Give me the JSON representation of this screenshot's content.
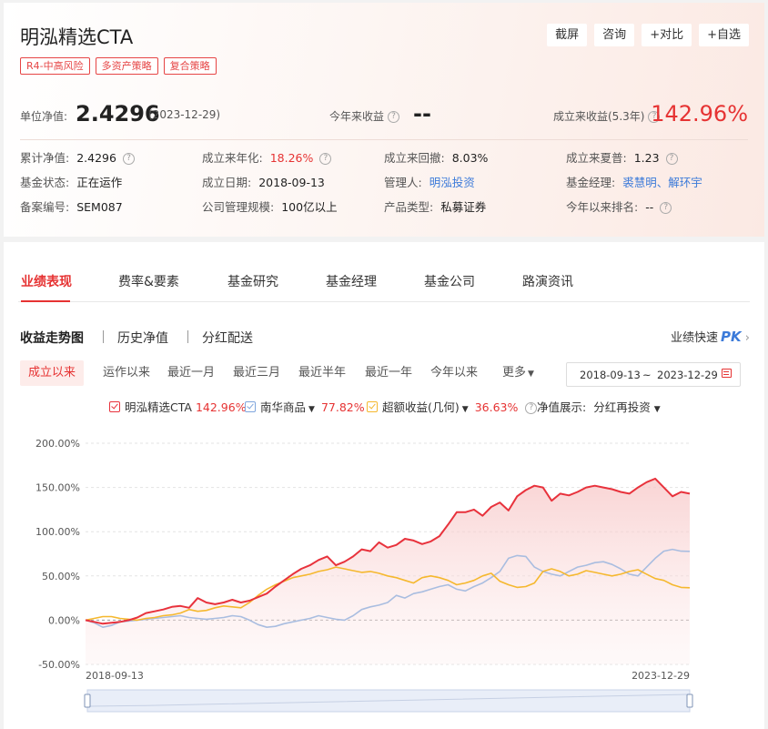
{
  "fund": {
    "title": "明泓精选CTA",
    "tags": [
      "R4-中高风险",
      "多资产策略",
      "复合策略"
    ],
    "actions": [
      "截屏",
      "咨询",
      "+对比",
      "+自选"
    ],
    "nav_label": "单位净值:",
    "nav_value": "2.4296",
    "nav_date": "(2023-12-29)",
    "ytd_label": "今年来收益",
    "ytd_value": "--",
    "since_label": "成立来收益(5.3年)",
    "since_value": "142.96%"
  },
  "info": [
    [
      {
        "label": "累计净值:",
        "value": "2.4296",
        "help": true,
        "style": ""
      },
      {
        "label": "成立来年化:",
        "value": "18.26%",
        "help": true,
        "style": "red"
      },
      {
        "label": "成立来回撤:",
        "value": "8.03%",
        "help": false,
        "style": ""
      },
      {
        "label": "成立来夏普:",
        "value": "1.23",
        "help": true,
        "style": ""
      }
    ],
    [
      {
        "label": "基金状态:",
        "value": "正在运作",
        "help": false,
        "style": ""
      },
      {
        "label": "成立日期:",
        "value": "2018-09-13",
        "help": false,
        "style": ""
      },
      {
        "label": "管理人:",
        "value": "明泓投资",
        "help": false,
        "style": "link"
      },
      {
        "label": "基金经理:",
        "value": "裘慧明、解环宇",
        "help": false,
        "style": "link"
      }
    ],
    [
      {
        "label": "备案编号:",
        "value": "SEM087",
        "help": false,
        "style": ""
      },
      {
        "label": "公司管理规模:",
        "value": "100亿以上",
        "help": false,
        "style": ""
      },
      {
        "label": "产品类型:",
        "value": "私募证券",
        "help": false,
        "style": ""
      },
      {
        "label": "今年以来排名:",
        "value": "--",
        "help": true,
        "style": ""
      }
    ]
  ],
  "tabs": [
    "业绩表现",
    "费率&要素",
    "基金研究",
    "基金经理",
    "基金公司",
    "路演资讯"
  ],
  "subtabs": [
    "收益走势图",
    "历史净值",
    "分红配送"
  ],
  "pk_label": "业绩快速",
  "pk_badge": "PK",
  "ranges": [
    "成立以来",
    "运作以来",
    "最近一月",
    "最近三月",
    "最近半年",
    "最近一年",
    "今年以来",
    "更多"
  ],
  "date_from": "2018-09-13",
  "date_sep": "~",
  "date_to": "2023-12-29",
  "legend": {
    "fund_name": "明泓精选CTA",
    "fund_pct": "142.96%",
    "bench_name": "南华商品",
    "bench_pct": "77.82%",
    "excess_name": "超额收益(几何)",
    "excess_pct": "36.63%",
    "nav_display_label": "净值展示:",
    "nav_display_value": "分红再投资"
  },
  "colors": {
    "accent": "#e63333",
    "fund": "#e8323c",
    "benchmark": "#a9bde0",
    "excess": "#f5b82e",
    "link": "#3b7ad9"
  },
  "chart_data": {
    "type": "line",
    "x_start": "2018-09-13",
    "x_end": "2023-12-29",
    "x_tick_labels": [
      "2018-09-13",
      "2023-12-29"
    ],
    "y_ticks": [
      "200.00%",
      "150.00%",
      "100.00%",
      "50.00%",
      "0.00%",
      "-50.00%"
    ],
    "ylim": [
      -50,
      200
    ],
    "grid": true,
    "series": [
      {
        "name": "明泓精选CTA",
        "color": "#e8323c",
        "area": true,
        "values": [
          0,
          -2,
          -4,
          -3,
          -2,
          0,
          3,
          8,
          10,
          12,
          15,
          16,
          14,
          25,
          20,
          18,
          20,
          23,
          20,
          22,
          26,
          30,
          38,
          45,
          52,
          58,
          62,
          68,
          72,
          62,
          66,
          72,
          80,
          78,
          88,
          82,
          85,
          92,
          90,
          86,
          89,
          95,
          108,
          122,
          122,
          125,
          118,
          128,
          133,
          124,
          140,
          147,
          152,
          150,
          135,
          143,
          141,
          145,
          150,
          152,
          150,
          148,
          145,
          143,
          150,
          156,
          160,
          150,
          140,
          145,
          143
        ]
      },
      {
        "name": "南华商品",
        "color": "#a9bde0",
        "area": false,
        "values": [
          0,
          -3,
          -8,
          -6,
          -2,
          -1,
          0,
          1,
          2,
          3,
          4,
          5,
          3,
          2,
          1,
          2,
          3,
          5,
          4,
          0,
          -5,
          -8,
          -7,
          -4,
          -2,
          0,
          2,
          5,
          3,
          1,
          0,
          5,
          12,
          15,
          17,
          20,
          28,
          25,
          30,
          32,
          35,
          38,
          40,
          35,
          33,
          38,
          42,
          48,
          55,
          70,
          73,
          72,
          60,
          55,
          52,
          50,
          55,
          60,
          62,
          65,
          66,
          63,
          58,
          52,
          50,
          60,
          70,
          78,
          80,
          78,
          77.82
        ]
      },
      {
        "name": "超额收益(几何)",
        "color": "#f5b82e",
        "area": false,
        "values": [
          0,
          2,
          4,
          4,
          2,
          1,
          0,
          2,
          3,
          5,
          6,
          8,
          12,
          10,
          11,
          14,
          16,
          15,
          14,
          20,
          28,
          35,
          40,
          44,
          48,
          50,
          52,
          55,
          57,
          60,
          58,
          56,
          54,
          55,
          53,
          50,
          48,
          45,
          42,
          48,
          50,
          48,
          45,
          40,
          42,
          45,
          50,
          53,
          44,
          40,
          37,
          38,
          42,
          55,
          58,
          55,
          50,
          52,
          56,
          54,
          52,
          50,
          52,
          55,
          57,
          52,
          47,
          45,
          40,
          37,
          36.63
        ]
      }
    ]
  }
}
